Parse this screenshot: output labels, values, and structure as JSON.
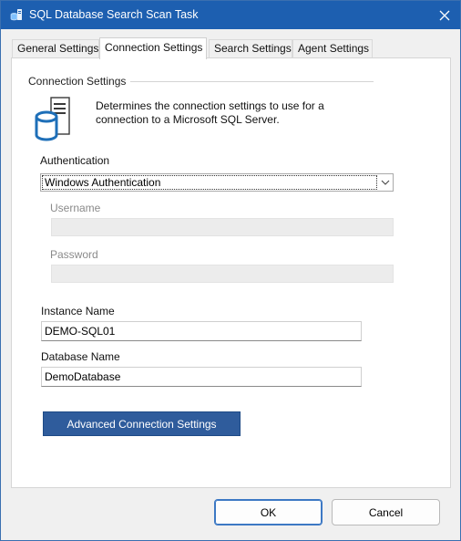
{
  "window": {
    "title": "SQL Database Search Scan Task",
    "icon": "app-icon",
    "close_icon": "close-icon"
  },
  "tabs": [
    {
      "label": "General Settings",
      "active": false
    },
    {
      "label": "Connection Settings",
      "active": true
    },
    {
      "label": "Search Settings",
      "active": false
    },
    {
      "label": "Agent Settings",
      "active": false
    }
  ],
  "connection": {
    "group_title": "Connection Settings",
    "description": "Determines the connection settings to use for a connection to a Microsoft SQL Server.",
    "icon": "database-server-icon",
    "authentication_label": "Authentication",
    "authentication_value": "Windows Authentication",
    "username_label": "Username",
    "username_value": "",
    "password_label": "Password",
    "password_value": "",
    "instance_label": "Instance Name",
    "instance_value": "DEMO-SQL01",
    "database_label": "Database Name",
    "database_value": "DemoDatabase",
    "advanced_button": "Advanced Connection Settings"
  },
  "footer": {
    "ok_label": "OK",
    "cancel_label": "Cancel"
  },
  "colors": {
    "titlebar": "#1d5fb0",
    "accent_button": "#2f5c9c",
    "icon_blue": "#1e6fb8"
  }
}
